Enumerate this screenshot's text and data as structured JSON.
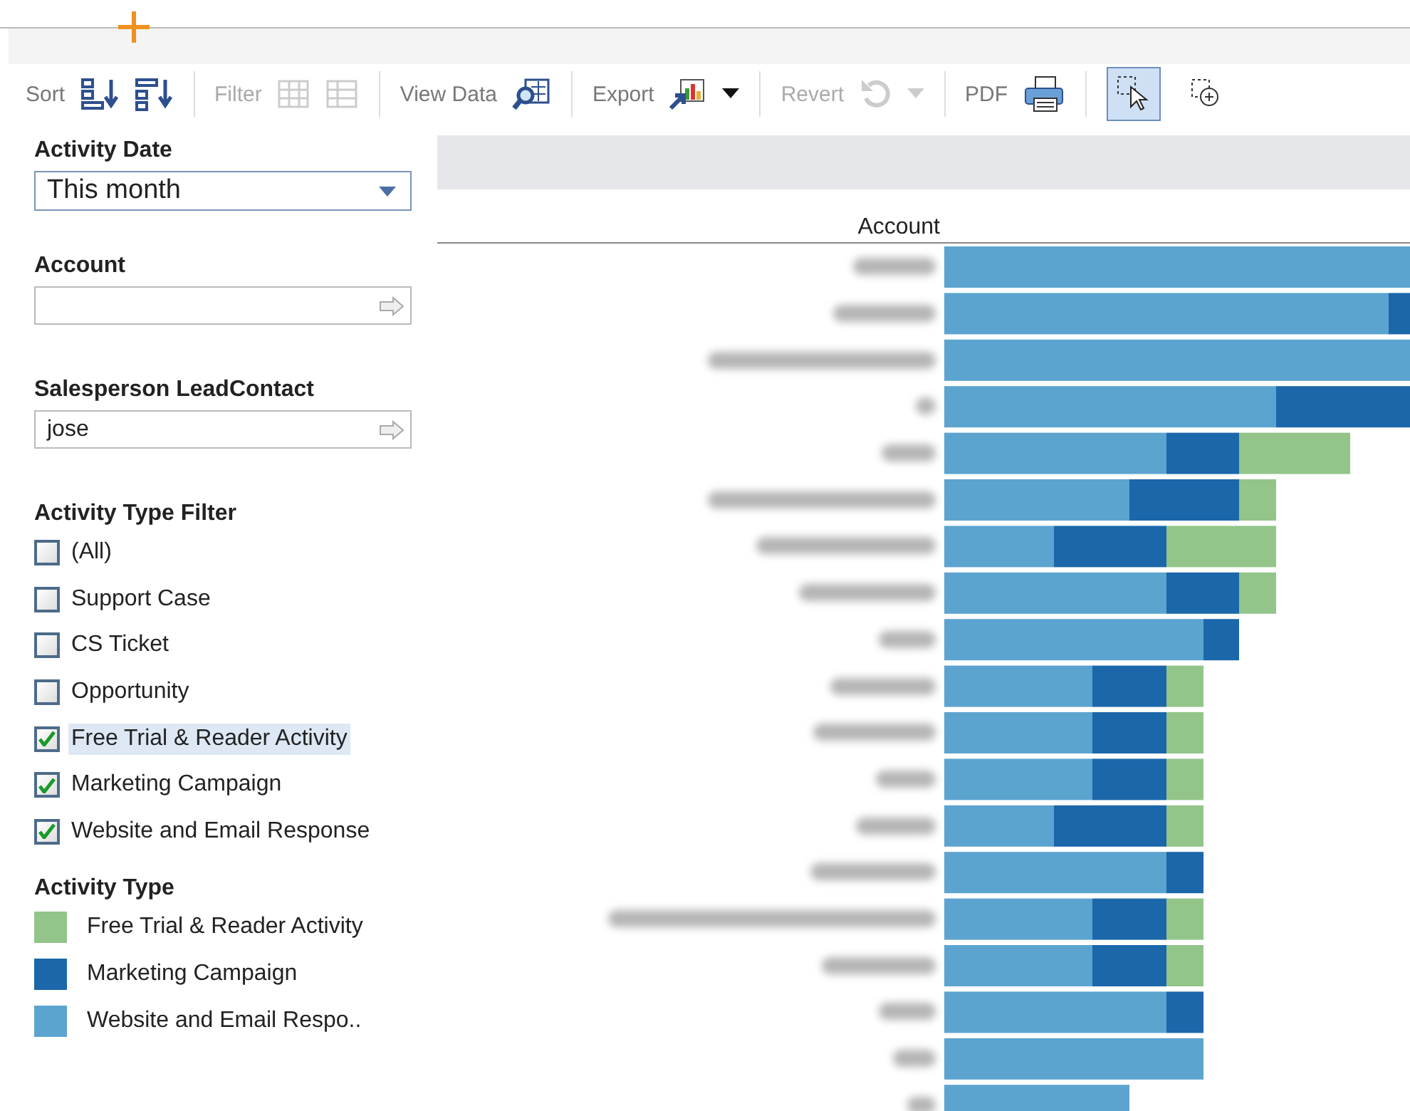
{
  "toolbar": {
    "groups": [
      {
        "label": "Sort",
        "disabled": false
      },
      {
        "label": "Filter",
        "disabled": true
      },
      {
        "label": "View Data",
        "disabled": false
      },
      {
        "label": "Export",
        "disabled": false
      },
      {
        "label": "Revert",
        "disabled": true
      },
      {
        "label": "PDF",
        "disabled": false
      }
    ],
    "tools": [
      {
        "selected": true
      },
      {
        "selected": false
      }
    ]
  },
  "filters": {
    "activity_date": {
      "label": "Activity Date",
      "value": "This month"
    },
    "account": {
      "label": "Account"
    },
    "salesperson": {
      "label": "Salesperson LeadContact",
      "value": "jose"
    }
  },
  "activity_type_filter": {
    "label": "Activity Type Filter",
    "items": [
      {
        "label": "(All)",
        "checked": false,
        "selected": false
      },
      {
        "label": "Support Case",
        "checked": false,
        "selected": false
      },
      {
        "label": "CS Ticket",
        "checked": false,
        "selected": false
      },
      {
        "label": "Opportunity",
        "checked": false,
        "selected": false
      },
      {
        "label": "Free Trial & Reader Activity",
        "checked": true,
        "selected": true
      },
      {
        "label": "Marketing Campaign",
        "checked": true,
        "selected": false
      },
      {
        "label": "Website and Email Response",
        "checked": true,
        "selected": false
      }
    ]
  },
  "legend": {
    "title": "Activity Type",
    "items": [
      {
        "label": "Free Trial & Reader Activity",
        "color": "#93c58a"
      },
      {
        "label": "Marketing Campaign",
        "color": "#1b67aa"
      },
      {
        "label": "Website and Email Respo..",
        "color": "#5ca4d0"
      }
    ]
  },
  "chart": {
    "row_header": "Account"
  }
}
